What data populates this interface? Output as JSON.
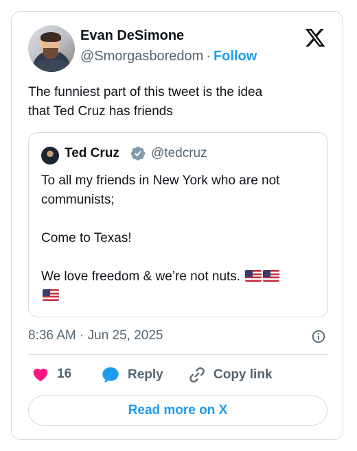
{
  "author": {
    "name": "Evan DeSimone",
    "handle": "@Smorgasboredom",
    "separator": "·",
    "follow_label": "Follow"
  },
  "brand": {
    "logo_icon": "x-logo-icon"
  },
  "tweet": {
    "text_line1": "The funniest part of this tweet is the idea",
    "text_line2": "that Ted Cruz has friends"
  },
  "quoted": {
    "name": "Ted Cruz",
    "handle": "@tedcruz",
    "verified_icon": "verified-badge-icon",
    "line1": "To all my friends in New York who are not",
    "line2": "communists;",
    "line3": "Come to Texas!",
    "line4": "We love freedom & we’re not nuts."
  },
  "timestamp": "8:36 AM · Jun 25, 2025",
  "actions": {
    "like_count": "16",
    "reply_label": "Reply",
    "copy_label": "Copy link"
  },
  "read_more_label": "Read more on X",
  "colors": {
    "accent": "#1d9bf0",
    "like": "#f91880",
    "text": "#0f1419",
    "muted": "#536471",
    "border": "#cfd9de"
  }
}
